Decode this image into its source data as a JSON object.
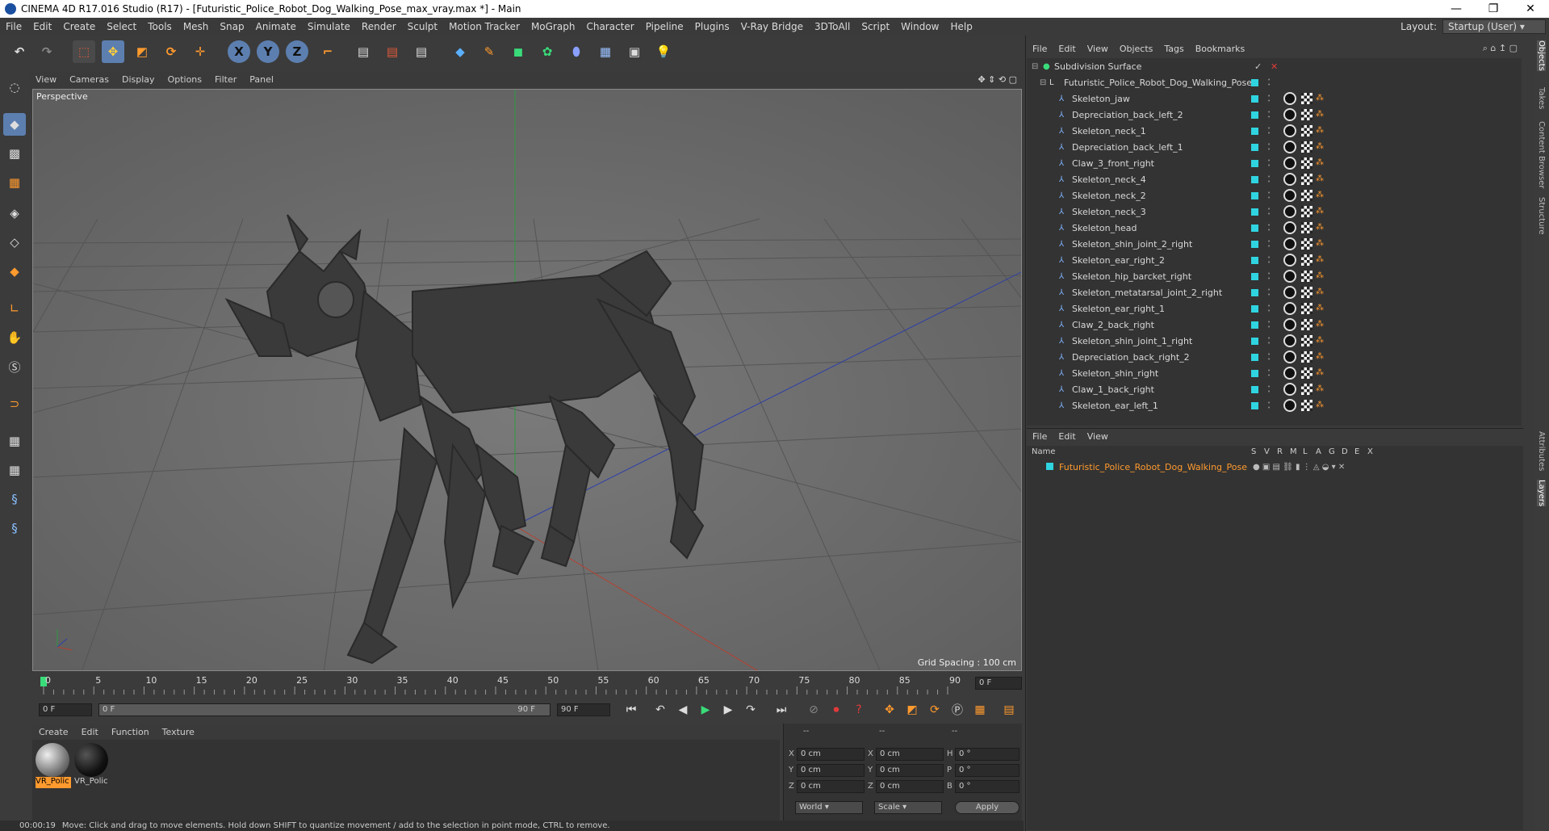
{
  "window": {
    "title": "CINEMA 4D R17.016 Studio (R17) - [Futuristic_Police_Robot_Dog_Walking_Pose_max_vray.max *] - Main",
    "minimize": "—",
    "maximize": "❐",
    "close": "✕"
  },
  "menu": [
    "File",
    "Edit",
    "Create",
    "Select",
    "Tools",
    "Mesh",
    "Snap",
    "Animate",
    "Simulate",
    "Render",
    "Sculpt",
    "Motion Tracker",
    "MoGraph",
    "Character",
    "Pipeline",
    "Plugins",
    "V-Ray Bridge",
    "3DToAll",
    "Script",
    "Window",
    "Help"
  ],
  "layout": {
    "label": "Layout:",
    "value": "Startup (User)"
  },
  "viewport": {
    "menu": [
      "View",
      "Cameras",
      "Display",
      "Options",
      "Filter",
      "Panel"
    ],
    "label": "Perspective",
    "grid_spacing": "Grid Spacing : 100 cm"
  },
  "timeline": {
    "ticks": [
      "0",
      "5",
      "10",
      "15",
      "20",
      "25",
      "30",
      "35",
      "40",
      "45",
      "50",
      "55",
      "60",
      "65",
      "70",
      "75",
      "80",
      "85",
      "90"
    ],
    "current_frame": "0 F",
    "start_field": "0 F",
    "range_start": "0 F",
    "range_end": "90 F",
    "end_field": "90 F"
  },
  "materials": {
    "menu": [
      "Create",
      "Edit",
      "Function",
      "Texture"
    ],
    "items": [
      {
        "label": "VR_Polic"
      },
      {
        "label": "VR_Polic"
      }
    ]
  },
  "coords": {
    "headers": [
      "--",
      "--",
      "--"
    ],
    "rows": [
      {
        "a": "X",
        "av": "0 cm",
        "b": "X",
        "bv": "0 cm",
        "c": "H",
        "cv": "0 °"
      },
      {
        "a": "Y",
        "av": "0 cm",
        "b": "Y",
        "bv": "0 cm",
        "c": "P",
        "cv": "0 °"
      },
      {
        "a": "Z",
        "av": "0 cm",
        "b": "Z",
        "bv": "0 cm",
        "c": "B",
        "cv": "0 °"
      }
    ],
    "world": "World",
    "scale": "Scale",
    "apply": "Apply"
  },
  "status": {
    "time": "00:00:19",
    "message": "Move: Click and drag to move elements. Hold down SHIFT to quantize movement / add to the selection in point mode, CTRL to remove."
  },
  "objects": {
    "menu": [
      "File",
      "Edit",
      "View",
      "Objects",
      "Tags",
      "Bookmarks"
    ],
    "root": "Subdivision Surface",
    "group": "Futuristic_Police_Robot_Dog_Walking_Pose",
    "children": [
      "Skeleton_jaw",
      "Depreciation_back_left_2",
      "Skeleton_neck_1",
      "Depreciation_back_left_1",
      "Claw_3_front_right",
      "Skeleton_neck_4",
      "Skeleton_neck_2",
      "Skeleton_neck_3",
      "Skeleton_head",
      "Skeleton_shin_joint_2_right",
      "Skeleton_ear_right_2",
      "Skeleton_hip_barcket_right",
      "Skeleton_metatarsal_joint_2_right",
      "Skeleton_ear_right_1",
      "Claw_2_back_right",
      "Skeleton_shin_joint_1_right",
      "Depreciation_back_right_2",
      "Skeleton_shin_right",
      "Claw_1_back_right",
      "Skeleton_ear_left_1"
    ]
  },
  "layers": {
    "menu": [
      "File",
      "Edit",
      "View"
    ],
    "columns": {
      "name": "Name",
      "flags": [
        "S",
        "V",
        "R",
        "M",
        "L",
        "A",
        "G",
        "D",
        "E",
        "X"
      ]
    },
    "items": [
      "Futuristic_Police_Robot_Dog_Walking_Pose"
    ]
  },
  "side_tabs": [
    "Objects",
    "Takes",
    "Content Browser",
    "Structure",
    "Attributes",
    "Layers"
  ],
  "colors": {
    "accent_orange": "#ff9a2e",
    "layer_cyan": "#2fd4e0",
    "axis_x": "#c0392b",
    "axis_y": "#27ae60",
    "axis_z": "#2c3ea8"
  }
}
